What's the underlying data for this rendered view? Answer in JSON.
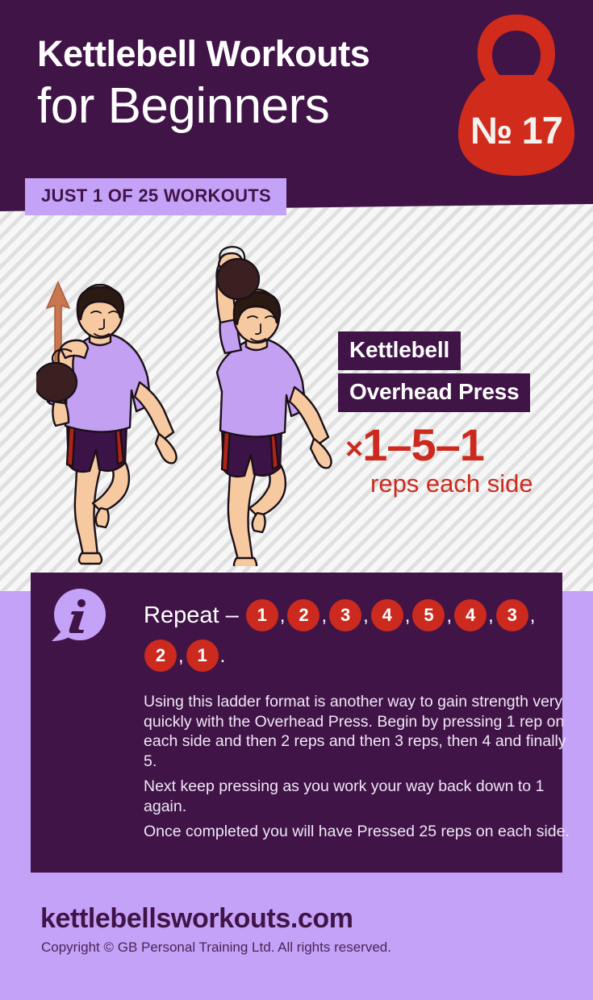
{
  "header": {
    "title_line1": "Kettlebell Workouts",
    "title_line2": "for Beginners",
    "badge_number": "№ 17",
    "subbanner": "JUST 1 OF 25 WORKOUTS"
  },
  "exercise": {
    "label_line1": "Kettlebell",
    "label_line2": "Overhead Press",
    "reps_mark": "×",
    "reps_value": "1–5–1",
    "reps_caption": "reps each side"
  },
  "instructions": {
    "info_icon": "info-bubble-icon",
    "repeat_label": "Repeat –",
    "ladder": [
      "1",
      "2",
      "3",
      "4",
      "5",
      "4",
      "3",
      "2",
      "1"
    ],
    "separator": ",",
    "terminator": ".",
    "paragraphs": [
      "Using this ladder format is another way to gain strength very quickly with the Overhead Press. Begin by pressing 1 rep on each side and then 2 reps and then 3 reps, then 4 and finally 5.",
      "Next keep pressing as you work your way back down to 1 again.",
      "Once completed you will have Pressed 25 reps on each side."
    ]
  },
  "footer": {
    "url": "kettlebellsworkouts.com",
    "copyright": "Copyright © GB Personal Training Ltd. All rights reserved."
  },
  "illustration": {
    "figure_1": "athlete-rack-position-figure",
    "figure_2": "athlete-overhead-lockout-figure",
    "arrow": "up-arrow-icon"
  },
  "colors": {
    "dark_purple": "#401447",
    "lavender": "#c4a2f7",
    "red": "#cc2a1e",
    "shirt": "#c3a0f2",
    "shorts": "#3b1347",
    "skin": "#f7c9a0",
    "kettlebell": "#3a2020",
    "arrow": "#c8774f",
    "white": "#ffffff"
  }
}
